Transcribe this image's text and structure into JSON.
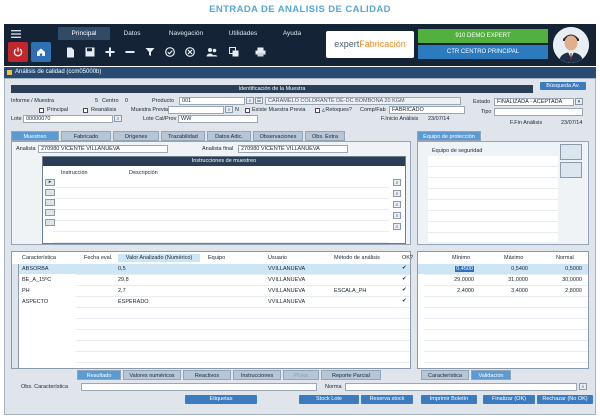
{
  "page_title": "ENTRADA DE ANALISIS DE CALIDAD",
  "menu": {
    "tabs": [
      "Principal",
      "Datos",
      "Navegación",
      "Utilidades",
      "Ayuda"
    ]
  },
  "brand": {
    "prefix": "expert",
    "suffix": "Fabricación"
  },
  "session": {
    "company": "910 DEMO EXPERT",
    "center": "CTR CENTRO PRINCIPAL"
  },
  "window": {
    "title": "Análisis de calidad  (ccm05000b)"
  },
  "ident": {
    "header": "Identificación de la Muestra",
    "search_btn": "Búsqueda Av."
  },
  "fields": {
    "informe_label": "Informe / Muestra",
    "informe_value": "5",
    "centro_label": "Centro",
    "centro_value": "0",
    "producto_label": "Producto",
    "producto_value": "001",
    "producto_desc": "CARAMELO COLORANTE DE-DC BOMBONA 20 KGM",
    "principal_label": "Principal",
    "reanalisis_label": "Reanálisis",
    "muestra_previa_label": "Muestra Previa",
    "muestra_previa_value": "N",
    "existe_label": "Existe Muestra Previa",
    "retoques_label": "¿Retoques?",
    "compfab_label": "Comp/Fab",
    "compfab_value": "FABRICADO",
    "lote_label": "Lote",
    "lote_value": "00000070",
    "lotecal_label": "Lote Cal/Prov",
    "lotecal_value": "WW",
    "finicio_label": "F.Inicio Análisis",
    "finicio_value": "23/07/14",
    "estado_label": "Estado",
    "estado_value": "FINALIZADA - ACEPTADA",
    "tipo_label": "Tipo",
    "ffin_label": "F.Fin  Análisis",
    "ffin_value": "23/07/14"
  },
  "tabs": [
    "Muestreo",
    "Fabricado",
    "Orígenes",
    "Trazabilidad",
    "Datos Adic.",
    "Observaciones",
    "Obs. Extra"
  ],
  "epp": {
    "tab": "Equipo de protección",
    "col": "Equipo de seguridad"
  },
  "muestreo": {
    "analista_label": "Analista",
    "analista_value": "270980 VICENTE VILLANUEVA",
    "analista_final_label": "Analista final",
    "analista_final_value": "270980 VICENTE VILLANUEVA"
  },
  "instrucciones": {
    "title": "Instrucciones de muestreo",
    "col1": "Instrucción",
    "col2": "Descripción"
  },
  "results": {
    "headers": {
      "caract": "Característica",
      "fecha": "Fecha eval.",
      "valor": "Valor Analizado (Numérico)",
      "equipo": "Equipo",
      "usuario": "Usuario",
      "metodo": "Método de análisis",
      "ok": "OK?"
    },
    "rows": [
      {
        "caract": "ABSORBA",
        "valor": "0,5",
        "usuario": "VVILLANUEVA",
        "metodo": "",
        "ok": "✔"
      },
      {
        "caract": "BE_A_15ºC",
        "valor": "29,8",
        "usuario": "VVILLANUEVA",
        "metodo": "",
        "ok": "✔"
      },
      {
        "caract": "PH",
        "valor": "2,7",
        "usuario": "VVILLANUEVA",
        "metodo": "ESCALA_PH",
        "ok": "✔"
      },
      {
        "caract": "ASPECTO",
        "valor": "ESPERADO",
        "usuario": "VVILLANUEVA",
        "metodo": "",
        "ok": "✔"
      }
    ]
  },
  "limits": {
    "headers": {
      "min": "Mínimo",
      "max": "Máximo",
      "normal": "Normal"
    },
    "rows": [
      {
        "min": "0,4500",
        "max": "0,5400",
        "normal": "0,5000"
      },
      {
        "min": "29,0000",
        "max": "31,0000",
        "normal": "30,0000"
      },
      {
        "min": "2,4000",
        "max": "3,4000",
        "normal": "2,8000"
      }
    ]
  },
  "bottom_tabs": [
    "Resultado",
    "Valores numéricos",
    "Reactivos",
    "Instrucciones",
    "Pl.eta",
    "Reporte Parcial"
  ],
  "right_tabs": [
    "Característica",
    "Validación"
  ],
  "obs": {
    "label": "Obs. Característica",
    "norma_label": "Norma"
  },
  "actions": {
    "etiquetas": "Etiquetas",
    "stock_lote": "Stock Lote",
    "reserva_stock": "Reserva stock",
    "imprimir": "Imprimir Boletín",
    "finalizar": "Finalizar (OK)",
    "rechazar": "Rechazar (No OK)"
  }
}
